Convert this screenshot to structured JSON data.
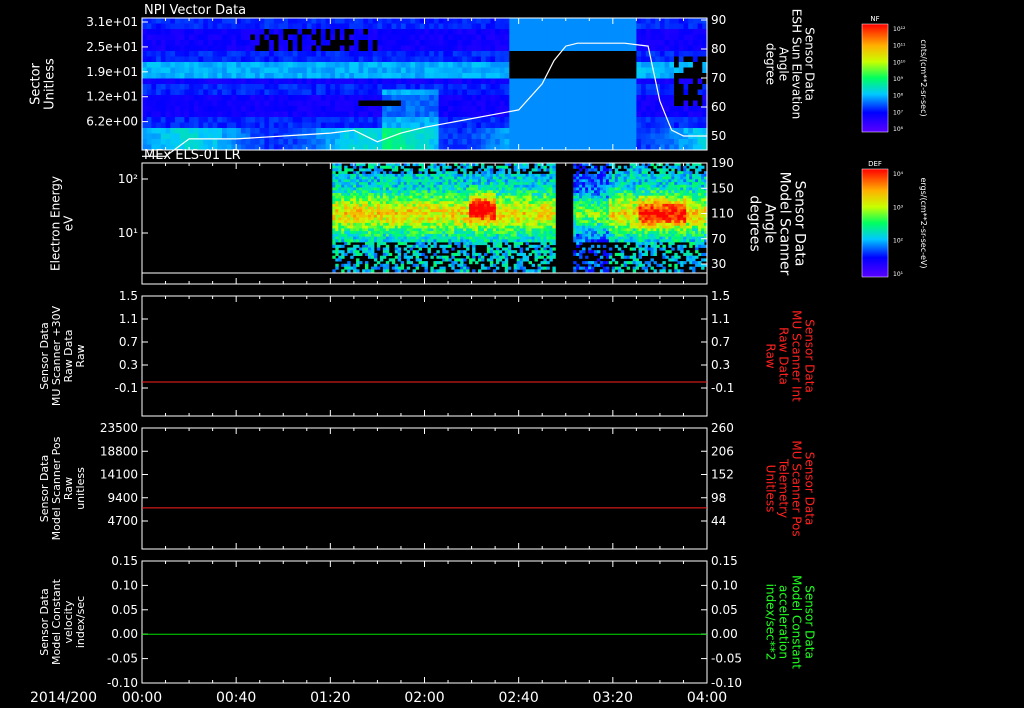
{
  "date_label": "2014/200",
  "time_ticks": [
    "00:00",
    "00:40",
    "01:20",
    "02:00",
    "02:40",
    "03:20",
    "04:00"
  ],
  "chart_data": [
    {
      "type": "heatmap",
      "title": "NPI Vector Data",
      "ylabel": [
        "Sector",
        "Unitless"
      ],
      "yticks": [
        "3.1e+01",
        "2.5e+01",
        "1.9e+01",
        "1.2e+01",
        "6.2e+00"
      ],
      "right_ylabel": [
        "Sensor Data",
        "ESH Sun Elevation",
        "Angle",
        "degree"
      ],
      "right_yticks": [
        "90",
        "80",
        "70",
        "60",
        "50"
      ],
      "right_ylim": [
        40,
        90
      ],
      "overlay_line": {
        "color": "#ffffff",
        "x_minutes": [
          0,
          10,
          20,
          40,
          60,
          80,
          90,
          100,
          110,
          120,
          140,
          160,
          170,
          175,
          180,
          185,
          195,
          205,
          215,
          220,
          225,
          230,
          240
        ],
        "y": [
          43,
          43,
          49,
          49,
          50,
          51,
          52,
          48,
          51,
          53,
          56,
          59,
          68,
          76,
          81,
          82,
          82,
          82,
          81,
          62,
          52,
          50,
          50
        ]
      },
      "colorbar": {
        "label": "NF",
        "unit": "cnts/(cm**2-sr-sec)",
        "ticks": [
          "10¹²",
          "10¹¹",
          "10¹⁰",
          "10⁹",
          "10⁸",
          "10⁷",
          "10⁶"
        ]
      }
    },
    {
      "type": "heatmap",
      "title": "MEx ELS-01 LR",
      "ylabel": [
        "Electron Energy",
        "eV"
      ],
      "yticks": [
        "10²",
        "10¹"
      ],
      "right_ylabel": [
        "Sensor Data",
        "Model Scanner",
        "Angle",
        "degrees"
      ],
      "right_yticks": [
        "190",
        "150",
        "110",
        "70",
        "30"
      ],
      "right_ylim": [
        0,
        190
      ],
      "overlay_line": {
        "color": "#ffffff",
        "x_minutes": [
          0,
          240
        ],
        "y": [
          14,
          14
        ]
      },
      "colorbar": {
        "label": "DEF",
        "unit": "ergs/(cm**2-sr-sec-eV)",
        "ticks": [
          "10⁴",
          "10³",
          "10²",
          "10¹"
        ]
      }
    },
    {
      "type": "line",
      "ylabel": [
        "Sensor Data",
        "MU Scanner +30V",
        "Raw Data",
        "Raw"
      ],
      "yticks": [
        "1.5",
        "1.1",
        "0.7",
        "0.3",
        "-0.1"
      ],
      "ylim": [
        -0.3,
        1.5
      ],
      "right_ylabel": [
        "Sensor Data",
        "MU Scanner Int",
        "Raw Data",
        "Raw"
      ],
      "right_yticks": [
        "1.5",
        "1.1",
        "0.7",
        "0.3",
        "-0.1"
      ],
      "series": [
        {
          "color": "#ff2020",
          "x_minutes": [
            0,
            240
          ],
          "values": [
            0.0,
            0.0
          ]
        }
      ]
    },
    {
      "type": "line",
      "ylabel": [
        "Sensor Data",
        "Model Scanner Pos",
        "Raw",
        "unitless"
      ],
      "yticks": [
        "23500",
        "18800",
        "14100",
        "9400",
        "4700"
      ],
      "ylim": [
        0,
        23500
      ],
      "right_ylabel": [
        "Sensor Data",
        "MU Scanner Pos",
        "Telemetry",
        "Unitless"
      ],
      "right_yticks": [
        "260",
        "206",
        "152",
        "98",
        "44"
      ],
      "series": [
        {
          "color": "#ff2020",
          "x_minutes": [
            0,
            240
          ],
          "values": [
            7800,
            7800
          ]
        }
      ]
    },
    {
      "type": "line",
      "ylabel": [
        "Sensor Data",
        "Model Constant",
        "velocity",
        "index/sec"
      ],
      "yticks": [
        "0.15",
        "0.10",
        "0.05",
        "0.00",
        "-0.05",
        "-0.10"
      ],
      "ylim": [
        -0.1,
        0.15
      ],
      "right_ylabel": [
        "Sensor Data",
        "Model Constant",
        "acceleration",
        "index/sec**2"
      ],
      "right_yticks": [
        "0.15",
        "0.10",
        "0.05",
        "0.00",
        "-0.05",
        "-0.10"
      ],
      "series": [
        {
          "color": "#00e000",
          "x_minutes": [
            0,
            240
          ],
          "values": [
            0.0,
            0.0
          ]
        }
      ]
    }
  ],
  "colors": {
    "axis": "#ffffff",
    "red_label": "#ff2020",
    "green_label": "#20ff20"
  }
}
